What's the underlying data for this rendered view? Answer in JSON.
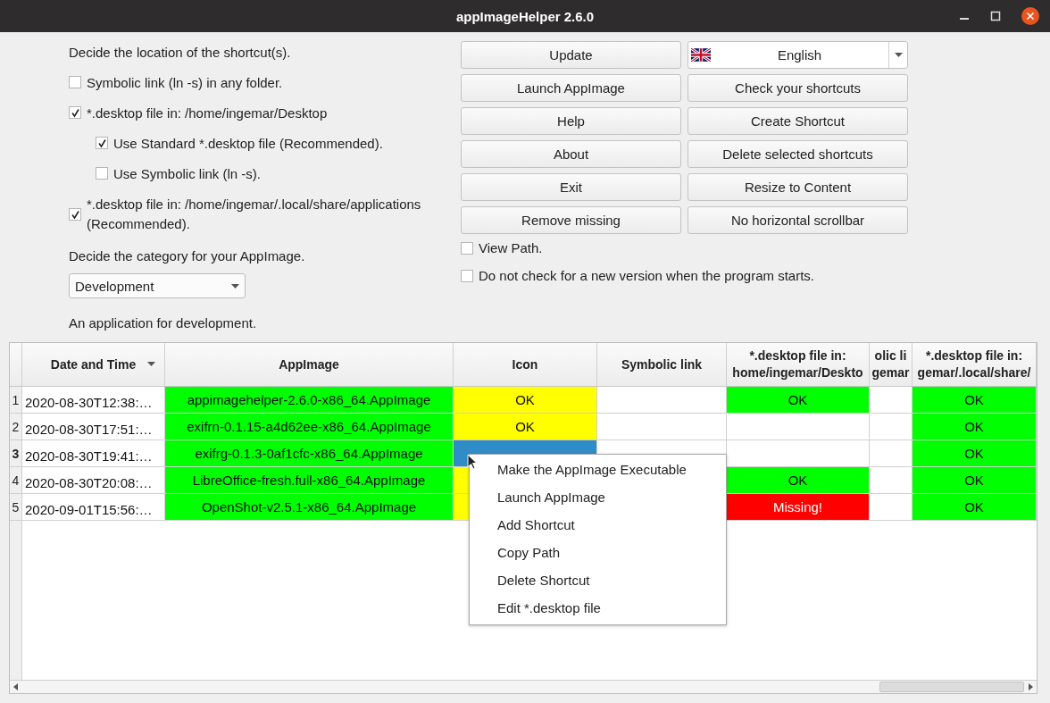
{
  "window": {
    "title": "appImageHelper 2.6.0"
  },
  "location": {
    "heading": "Decide the location of the shortcut(s).",
    "options": [
      {
        "label": "Symbolic link (ln -s) in any folder.",
        "checked": false
      },
      {
        "label": "*.desktop file in: /home/ingemar/Desktop",
        "checked": true,
        "children": [
          {
            "label": "Use Standard *.desktop file (Recommended).",
            "checked": true
          },
          {
            "label": "Use Symbolic link (ln -s).",
            "checked": false
          }
        ]
      },
      {
        "label": "*.desktop file in: /home/ingemar/.local/share/applications (Recommended).",
        "checked": true
      }
    ]
  },
  "category": {
    "heading": "Decide the category for your AppImage.",
    "value": "Development",
    "description": "An application for development."
  },
  "buttons_left": [
    "Update",
    "Launch AppImage",
    "Help",
    "About",
    "Exit",
    "Remove missing"
  ],
  "language": {
    "value": "English"
  },
  "buttons_right": [
    "Check your shortcuts",
    "Create Shortcut",
    "Delete selected shortcuts",
    "Resize to Content",
    "No horizontal scrollbar"
  ],
  "options": [
    {
      "label": "View Path.",
      "checked": false
    },
    {
      "label": "Do not check for a new version when the program starts.",
      "checked": false
    }
  ],
  "table": {
    "columns": [
      {
        "lines": [
          "Date and Time"
        ],
        "sorted": true
      },
      {
        "lines": [
          "AppImage"
        ],
        "sorted": false
      },
      {
        "lines": [
          "Icon"
        ],
        "sorted": false
      },
      {
        "lines": [
          "Symbolic link"
        ],
        "sorted": false
      },
      {
        "lines": [
          "*.desktop file in:",
          "home/ingemar/Deskto"
        ],
        "sorted": false
      },
      {
        "lines": [
          "olic li",
          "gemar"
        ],
        "sorted": false
      },
      {
        "lines": [
          "*.desktop file in:",
          "gemar/.local/share/"
        ],
        "sorted": false
      }
    ],
    "rows": [
      {
        "number": "1",
        "current": false,
        "cells": [
          {
            "text": "2020-08-30T12:38:…",
            "color": "#ffffff",
            "selected": false
          },
          {
            "text": "appimagehelper-2.6.0-x86_64.AppImage",
            "color": "#00ff00",
            "selected": false
          },
          {
            "text": "OK",
            "color": "#ffff00",
            "selected": false
          },
          {
            "color": "#ffffff",
            "selected": false
          },
          {
            "text": "OK",
            "color": "#00ff00",
            "selected": false
          },
          {
            "color": "#ffffff",
            "selected": false
          },
          {
            "text": "OK",
            "color": "#00ff00",
            "selected": false
          }
        ]
      },
      {
        "number": "2",
        "current": false,
        "cells": [
          {
            "text": "2020-08-30T17:51:…",
            "color": "#ffffff",
            "selected": false
          },
          {
            "text": "exifrn-0.1.15-a4d62ee-x86_64.AppImage",
            "color": "#00ff00",
            "selected": false
          },
          {
            "text": "OK",
            "color": "#ffff00",
            "selected": false
          },
          {
            "color": "#ffffff",
            "selected": false
          },
          {
            "color": "#ffffff",
            "selected": false
          },
          {
            "color": "#ffffff",
            "selected": false
          },
          {
            "text": "OK",
            "color": "#00ff00",
            "selected": false
          }
        ]
      },
      {
        "number": "3",
        "current": true,
        "cells": [
          {
            "text": "2020-08-30T19:41:…",
            "color": "#ffffff",
            "selected": false
          },
          {
            "text": "exifrg-0.1.3-0af1cfc-x86_64.AppImage",
            "color": "#00ff00",
            "selected": false
          },
          {
            "selected": true
          },
          {
            "color": "#ffffff",
            "selected": false
          },
          {
            "color": "#ffffff",
            "selected": false
          },
          {
            "color": "#ffffff",
            "selected": false
          },
          {
            "text": "OK",
            "color": "#00ff00",
            "selected": false
          }
        ]
      },
      {
        "number": "4",
        "current": false,
        "cells": [
          {
            "text": "2020-08-30T20:08:…",
            "color": "#ffffff",
            "selected": false
          },
          {
            "text": "LibreOffice-fresh.full-x86_64.AppImage",
            "color": "#00ff00",
            "selected": false
          },
          {
            "color": "#ffff00",
            "selected": false
          },
          {},
          {
            "text": "OK",
            "color": "#00ff00",
            "selected": false
          },
          {
            "color": "#ffffff",
            "selected": false
          },
          {
            "text": "OK",
            "color": "#00ff00",
            "selected": false
          }
        ]
      },
      {
        "number": "5",
        "current": false,
        "cells": [
          {
            "text": "2020-09-01T15:56:…",
            "color": "#ffffff",
            "selected": false
          },
          {
            "text": "OpenShot-v2.5.1-x86_64.AppImage",
            "color": "#00ff00",
            "selected": false
          },
          {
            "color": "#ffff00",
            "selected": false
          },
          {},
          {
            "text": "Missing!",
            "color": "#ff0000",
            "selected": false
          },
          {
            "color": "#ffffff",
            "selected": false
          },
          {
            "text": "OK",
            "color": "#00ff00",
            "selected": false
          }
        ]
      }
    ]
  },
  "context_menu": {
    "items": [
      "Make the AppImage Executable",
      "Launch AppImage",
      "Add Shortcut",
      "Copy Path",
      "Delete Shortcut",
      "Edit *.desktop file"
    ]
  }
}
